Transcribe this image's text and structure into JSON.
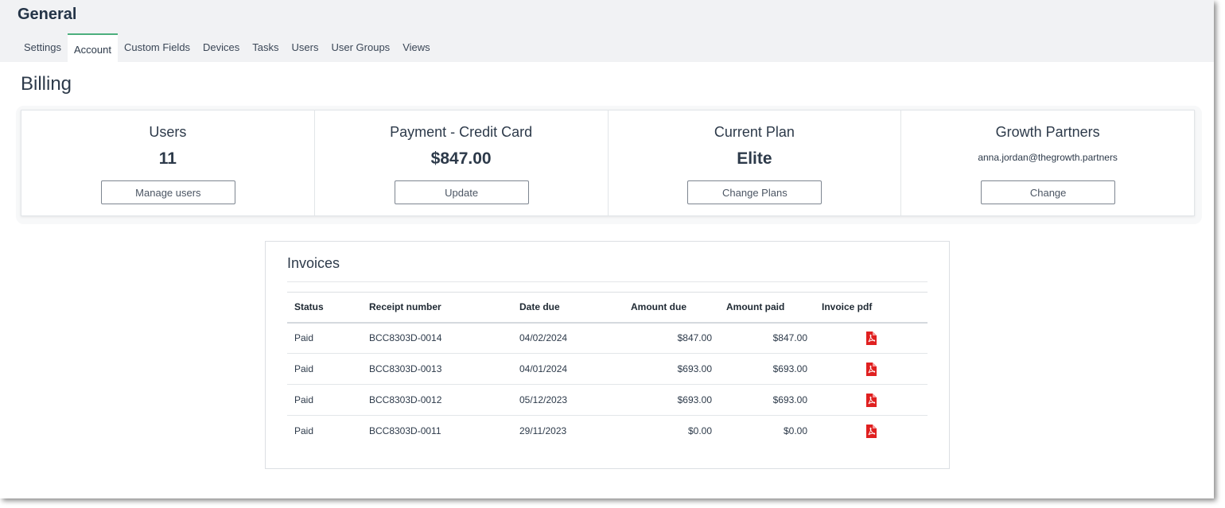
{
  "header": {
    "title": "General",
    "tabs": [
      {
        "label": "Settings",
        "active": false
      },
      {
        "label": "Account",
        "active": true
      },
      {
        "label": "Custom Fields",
        "active": false
      },
      {
        "label": "Devices",
        "active": false
      },
      {
        "label": "Tasks",
        "active": false
      },
      {
        "label": "Users",
        "active": false
      },
      {
        "label": "User Groups",
        "active": false
      },
      {
        "label": "Views",
        "active": false
      }
    ]
  },
  "billing": {
    "title": "Billing",
    "cards": {
      "users": {
        "title": "Users",
        "value": "11",
        "button": "Manage users"
      },
      "payment": {
        "title": "Payment - Credit Card",
        "value": "$847.00",
        "button": "Update"
      },
      "plan": {
        "title": "Current Plan",
        "value": "Elite",
        "button": "Change Plans"
      },
      "partner": {
        "title": "Growth Partners",
        "value": "anna.jordan@thegrowth.partners",
        "button": "Change"
      }
    }
  },
  "invoices": {
    "title": "Invoices",
    "columns": [
      "Status",
      "Receipt number",
      "Date due",
      "Amount due",
      "Amount paid",
      "Invoice pdf"
    ],
    "rows": [
      {
        "status": "Paid",
        "receipt": "BCC8303D-0014",
        "date_due": "04/02/2024",
        "amount_due": "$847.00",
        "amount_paid": "$847.00"
      },
      {
        "status": "Paid",
        "receipt": "BCC8303D-0013",
        "date_due": "04/01/2024",
        "amount_due": "$693.00",
        "amount_paid": "$693.00"
      },
      {
        "status": "Paid",
        "receipt": "BCC8303D-0012",
        "date_due": "05/12/2023",
        "amount_due": "$693.00",
        "amount_paid": "$693.00"
      },
      {
        "status": "Paid",
        "receipt": "BCC8303D-0011",
        "date_due": "29/11/2023",
        "amount_due": "$0.00",
        "amount_paid": "$0.00"
      }
    ],
    "pdf_icon": "pdf-file-icon"
  },
  "colors": {
    "accent": "#4caf7d",
    "pdf_red": "#e02020",
    "text": "#2d3a4a",
    "topbar_bg": "#f1f2f4"
  }
}
